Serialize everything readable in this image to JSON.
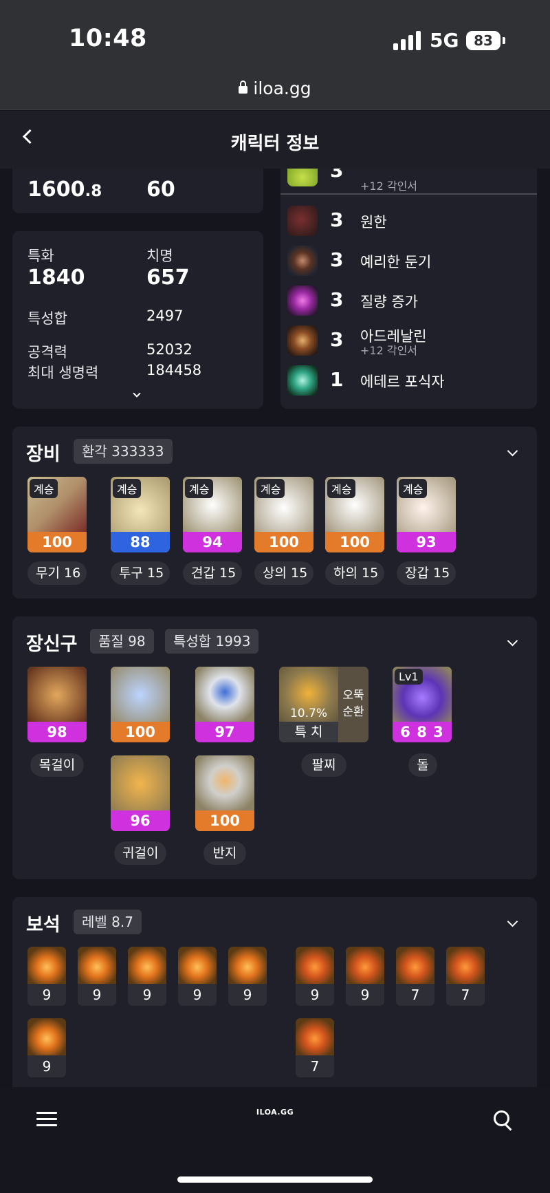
{
  "status_bar": {
    "time": "10:48",
    "network": "5G",
    "battery": "83"
  },
  "browser": {
    "url": "iloa.gg"
  },
  "header": {
    "title": "캐릭터 정보"
  },
  "stats_top": {
    "value1": "1600",
    "value1_decimal": ".8",
    "value2": "60"
  },
  "stats": {
    "crit_spec_label": "특화",
    "crit_spec_value": "1840",
    "crit_label": "치명",
    "crit_value": "657",
    "trait_sum_label": "특성합",
    "trait_sum_value": "2497",
    "attack_label": "공격력",
    "attack_value": "52032",
    "hp_label": "최대 생명력",
    "hp_value": "184458"
  },
  "engravings": {
    "partial": {
      "level": "3",
      "sub": "+12 각인서"
    },
    "items": [
      {
        "level": "3",
        "name": "원한",
        "sub": ""
      },
      {
        "level": "3",
        "name": "예리한 둔기",
        "sub": ""
      },
      {
        "level": "3",
        "name": "질량 증가",
        "sub": ""
      },
      {
        "level": "3",
        "name": "아드레날린",
        "sub": "+12 각인서"
      },
      {
        "level": "1",
        "name": "에테르 포식자",
        "sub": ""
      }
    ]
  },
  "equipment": {
    "title": "장비",
    "chip": "환각 333333",
    "tag": "계승",
    "items": [
      {
        "quality": "100",
        "label": "무기 16",
        "color": "#e47b2b"
      },
      {
        "quality": "88",
        "label": "투구 15",
        "color": "#2f64e0"
      },
      {
        "quality": "94",
        "label": "견갑 15",
        "color": "#cf31de"
      },
      {
        "quality": "100",
        "label": "상의 15",
        "color": "#e47b2b"
      },
      {
        "quality": "100",
        "label": "하의 15",
        "color": "#e47b2b"
      },
      {
        "quality": "93",
        "label": "장갑 15",
        "color": "#cf31de"
      }
    ]
  },
  "accessories": {
    "title": "장신구",
    "chip1": "품질 98",
    "chip2": "특성합 1993",
    "necklace": {
      "quality": "98",
      "label": "목걸이"
    },
    "earring1": {
      "quality": "100"
    },
    "earring2": {
      "quality": "96",
      "label": "귀걸이"
    },
    "ring1": {
      "quality": "97"
    },
    "ring2": {
      "quality": "100",
      "label": "반지"
    },
    "bracelet": {
      "percent": "10.7%",
      "stats": "특 치",
      "side": "오뚝\n순환",
      "label": "팔찌"
    },
    "stone": {
      "level": "Lv1",
      "value": "6 8 3",
      "label": "돌"
    },
    "colors": {
      "orange": "#e47b2b",
      "purple": "#cf31de"
    }
  },
  "gems": {
    "title": "보석",
    "chip": "레벨 8.7",
    "left": [
      "9",
      "9",
      "9",
      "9",
      "9",
      "9"
    ],
    "right": [
      "9",
      "9",
      "7",
      "7",
      "7"
    ]
  },
  "tabbar": {
    "logo": "ILOA.GG"
  }
}
